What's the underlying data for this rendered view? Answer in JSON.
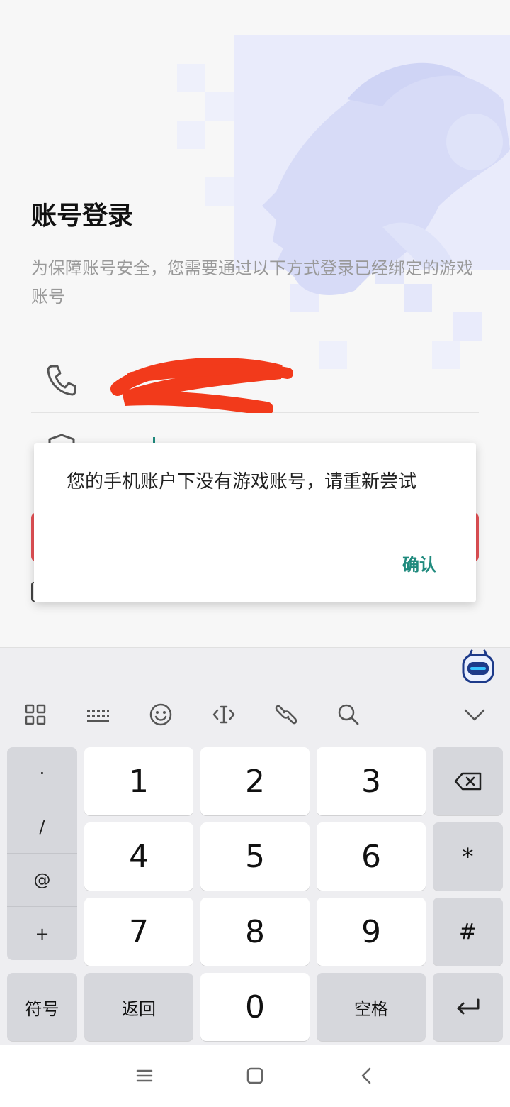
{
  "page": {
    "title": "账号登录",
    "description": "为保障账号安全，您需要通过以下方式登录已经绑定的游戏账号"
  },
  "dialog": {
    "message": "您的手机账户下没有游戏账号，请重新尝试",
    "confirm_label": "确认"
  },
  "keyboard": {
    "symbols": [
      "·",
      "/",
      "@",
      "+"
    ],
    "digits": [
      "1",
      "2",
      "3",
      "4",
      "5",
      "6",
      "7",
      "8",
      "9",
      "0"
    ],
    "star": "*",
    "hash": "#",
    "symbol_key": "符号",
    "back_key": "返回",
    "space_key": "空格"
  },
  "colors": {
    "accent": "#1f8a7d",
    "login_button": "#e55156",
    "redaction": "#f23a1b"
  },
  "icons": [
    "phone-icon",
    "shield-icon",
    "grid-icon",
    "keypad-icon",
    "emoji-icon",
    "cursor-move-icon",
    "link-icon",
    "search-icon",
    "chevron-down-icon",
    "backspace-icon",
    "enter-icon",
    "menu-icon",
    "home-icon",
    "back-icon",
    "assistant-icon"
  ]
}
